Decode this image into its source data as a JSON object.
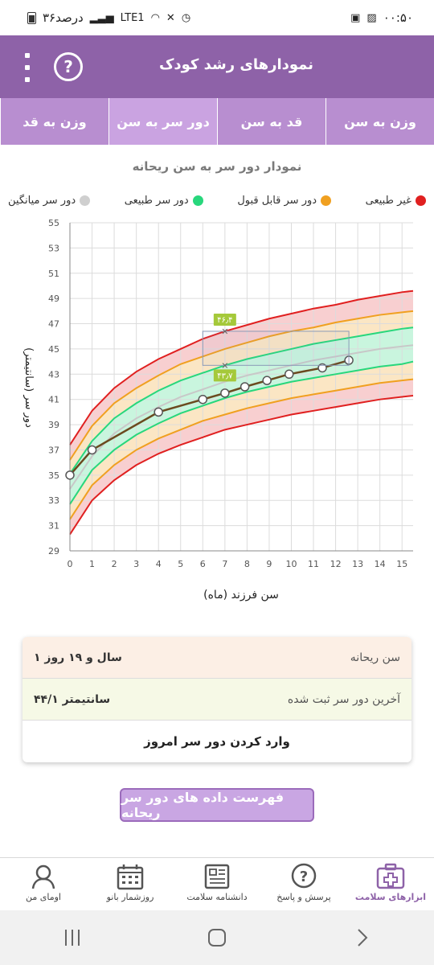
{
  "status_bar": {
    "time": "۰۰:۵۰",
    "battery_text": "۳۶درصد",
    "network": "LTE1"
  },
  "app_bar": {
    "title": "نمودارهای رشد کودک",
    "help_symbol": "?"
  },
  "tabs": [
    {
      "label": "وزن به سن",
      "active": false
    },
    {
      "label": "قد به سن",
      "active": false
    },
    {
      "label": "دور سر به سن",
      "active": true
    },
    {
      "label": "وزن به قد",
      "active": false
    }
  ],
  "chart_title": "نمودار دور سر به سن ریحانه",
  "legend": [
    {
      "label": "غیر طبیعی",
      "color": "#e02020"
    },
    {
      "label": "دور سر قابل قبول",
      "color": "#f0a020"
    },
    {
      "label": "دور سر طبیعی",
      "color": "#28d77c"
    },
    {
      "label": "دور سر میانگین",
      "color": "#cfcfcf"
    }
  ],
  "chart_data": {
    "type": "line",
    "title": "نمودار دور سر به سن ریحانه",
    "xlabel": "سن فرزند (ماه)",
    "ylabel": "دور سر (سانتیمتر)",
    "xlim": [
      0,
      15.5
    ],
    "ylim": [
      29,
      55
    ],
    "x_ticks": [
      0,
      1,
      2,
      3,
      4,
      5,
      6,
      7,
      8,
      9,
      10,
      11,
      12,
      13,
      14,
      15
    ],
    "y_ticks": [
      29,
      31,
      33,
      35,
      37,
      39,
      41,
      43,
      45,
      47,
      49,
      51,
      53,
      55
    ],
    "x_tick_labels": [
      "0",
      "1",
      "2",
      "3",
      "4",
      "5",
      "6",
      "7",
      "8",
      "9",
      "10",
      "11",
      "12",
      "13",
      "14",
      "15"
    ],
    "y_tick_labels": [
      "29",
      "31",
      "33",
      "35",
      "37",
      "39",
      "41",
      "43",
      "45",
      "47",
      "49",
      "51",
      "53",
      "55"
    ],
    "grid": true,
    "reference_x": [
      0,
      1,
      2,
      3,
      4,
      5,
      6,
      7,
      8,
      9,
      10,
      11,
      12,
      13,
      14,
      15,
      15.5
    ],
    "reference_curves": [
      {
        "name": "-3",
        "values": [
          30.3,
          33.0,
          34.6,
          35.8,
          36.7,
          37.4,
          38.0,
          38.6,
          39.0,
          39.4,
          39.8,
          40.1,
          40.4,
          40.7,
          41.0,
          41.2,
          41.3
        ]
      },
      {
        "name": "-2",
        "values": [
          31.5,
          34.2,
          35.8,
          37.0,
          37.9,
          38.6,
          39.3,
          39.8,
          40.3,
          40.7,
          41.1,
          41.4,
          41.7,
          42.0,
          42.3,
          42.5,
          42.6
        ]
      },
      {
        "name": "-1",
        "values": [
          32.7,
          35.4,
          37.0,
          38.2,
          39.1,
          39.9,
          40.5,
          41.1,
          41.6,
          42.0,
          42.4,
          42.7,
          43.0,
          43.3,
          43.6,
          43.8,
          44.0
        ]
      },
      {
        "name": "median",
        "values": [
          33.9,
          36.5,
          38.3,
          39.5,
          40.4,
          41.2,
          41.8,
          42.4,
          42.9,
          43.3,
          43.7,
          44.1,
          44.4,
          44.7,
          45.0,
          45.2,
          45.3
        ]
      },
      {
        "name": "+1",
        "values": [
          35.1,
          37.7,
          39.5,
          40.7,
          41.7,
          42.5,
          43.1,
          43.7,
          44.2,
          44.6,
          45.0,
          45.4,
          45.7,
          46.0,
          46.3,
          46.6,
          46.7
        ]
      },
      {
        "name": "+2",
        "values": [
          36.2,
          38.9,
          40.7,
          41.9,
          42.9,
          43.8,
          44.4,
          45.0,
          45.5,
          46.0,
          46.4,
          46.7,
          47.1,
          47.4,
          47.7,
          47.9,
          48.0
        ]
      },
      {
        "name": "+3",
        "values": [
          37.4,
          40.1,
          41.9,
          43.2,
          44.2,
          45.0,
          45.8,
          46.4,
          46.9,
          47.4,
          47.8,
          48.2,
          48.5,
          48.9,
          49.2,
          49.5,
          49.6
        ]
      }
    ],
    "band_colors": {
      "outer": "#f8cfd0",
      "middle": "#fbe6c4",
      "inner": "#c9f5de",
      "line_red": "#e02020",
      "line_orange": "#f0a020",
      "line_green": "#28d77c",
      "line_median": "#c8c8c8"
    },
    "series": [
      {
        "color": "#6b4a1f",
        "x": [
          0,
          1,
          4,
          6,
          7,
          7.9,
          8.9,
          9.9,
          11.4,
          12.6
        ],
        "values": [
          35.0,
          37.0,
          40.0,
          41.0,
          41.5,
          42.0,
          42.5,
          43.0,
          43.5,
          44.1
        ]
      }
    ],
    "annotations": [
      {
        "x": 7,
        "y": 46.4,
        "label": "۴۶٫۴"
      },
      {
        "x": 7,
        "y": 43.7,
        "label": "۴۳٫۷"
      }
    ],
    "highlight_box": {
      "x0": 6,
      "x1": 12.6,
      "y0": 43.7,
      "y1": 46.4
    }
  },
  "info": {
    "age_label": "سن ریحانه",
    "age_value": "۱ سال و ۱۹ روز",
    "last_label": "آخرین دور سر ثبت شده",
    "last_value": "۴۴/۱ سانتیمتر",
    "action_label": "وارد کردن دور سر امروز"
  },
  "list_button": "فهرست داده های دور سر ریحانه",
  "bottom_nav": [
    {
      "label": "ابزارهای سلامت",
      "icon": "health-kit-icon",
      "active": true
    },
    {
      "label": "پرسش و پاسخ",
      "icon": "question-icon",
      "active": false
    },
    {
      "label": "دانشنامه سلامت",
      "icon": "encyclopedia-icon",
      "active": false
    },
    {
      "label": "روزشمار بانو",
      "icon": "calendar-icon",
      "active": false
    },
    {
      "label": "اومای من",
      "icon": "profile-icon",
      "active": false
    }
  ]
}
